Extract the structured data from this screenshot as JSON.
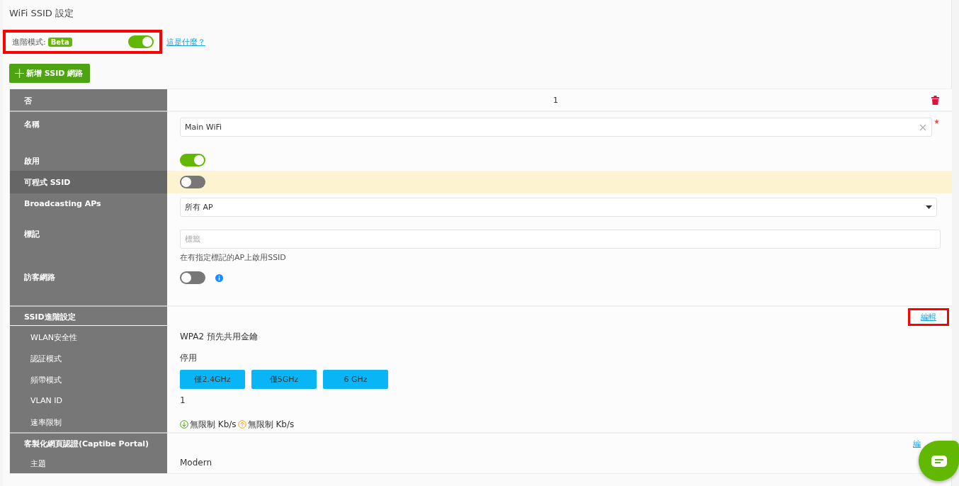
{
  "page_title": "WiFi SSID 設定",
  "advanced_mode": {
    "label": "進階模式:",
    "badge": "Beta",
    "on": true,
    "help_link": "這是什麼？",
    "highlighted": true
  },
  "add_button": "新增 SSID 網路",
  "ssid_table": {
    "header": {
      "label": "否",
      "value": "1"
    },
    "rows": [
      {
        "kind": "text-field",
        "label": "名稱",
        "value": "Main WiFi",
        "required": true
      },
      {
        "kind": "toggle",
        "label": "啟用",
        "on": true,
        "hovered": false
      },
      {
        "kind": "toggle",
        "label": "可程式 SSID",
        "on": false,
        "hovered": true
      },
      {
        "kind": "select",
        "label": "Broadcasting APs",
        "value": "所有 AP"
      },
      {
        "kind": "tag-field",
        "label": "標記",
        "placeholder": "標籤",
        "hint": "在有指定標記的AP上啟用SSID"
      },
      {
        "kind": "toggle-info",
        "label": "訪客網路",
        "on": false
      }
    ]
  },
  "sections": [
    {
      "title": "SSID進階設定",
      "edit_link": "編輯",
      "highlighted": true,
      "rows": [
        {
          "kind": "text",
          "label": "WLAN安全性",
          "value": "WPA2 預先共用金鑰"
        },
        {
          "kind": "text",
          "label": "認証模式",
          "value": "停用"
        },
        {
          "kind": "bands",
          "label": "頻帶模式",
          "bands": [
            "僅2.4GHz",
            "僅5GHz",
            "6 GHz"
          ]
        },
        {
          "kind": "text",
          "label": "VLAN ID",
          "value": "1"
        },
        {
          "kind": "rate",
          "label": "速率限制",
          "download": "無限制 Kb/s",
          "upload": "無限制 Kb/s"
        }
      ]
    },
    {
      "title": "客製化網頁認證(Captibe Portal)",
      "edit_link": "編",
      "highlighted": false,
      "rows": [
        {
          "kind": "text",
          "label": "主題",
          "value": "Modern"
        }
      ]
    }
  ]
}
